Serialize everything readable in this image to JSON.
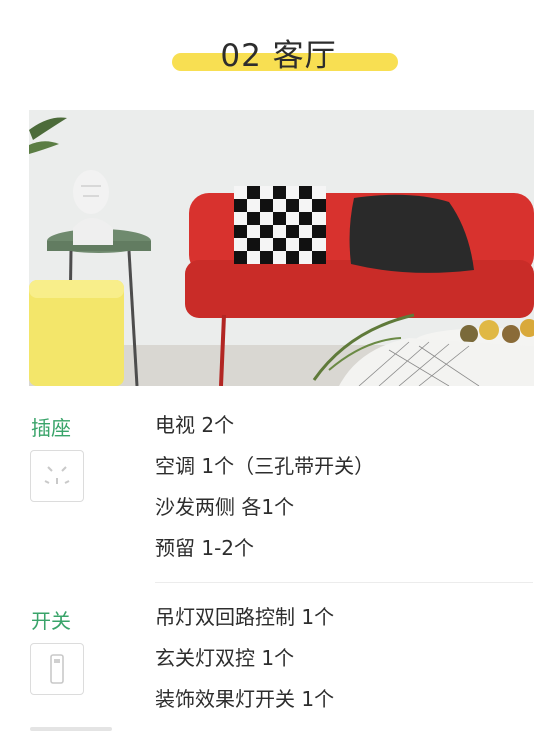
{
  "header": {
    "title": "02 客厅"
  },
  "photo": {
    "icon": "living-room-photo"
  },
  "sections": [
    {
      "label": "插座",
      "icon": "socket-icon",
      "items": [
        "电视 2个",
        "空调 1个（三孔带开关）",
        "沙发两侧 各1个",
        "预留 1-2个"
      ]
    },
    {
      "label": "开关",
      "icon": "switch-icon",
      "items": [
        "吊灯双回路控制 1个",
        "玄关灯双控 1个",
        "装饰效果灯开关 1个"
      ]
    }
  ],
  "colors": {
    "accent_yellow": "#f8df52",
    "label_green": "#3aa46a",
    "sofa_red": "#d8322e"
  }
}
